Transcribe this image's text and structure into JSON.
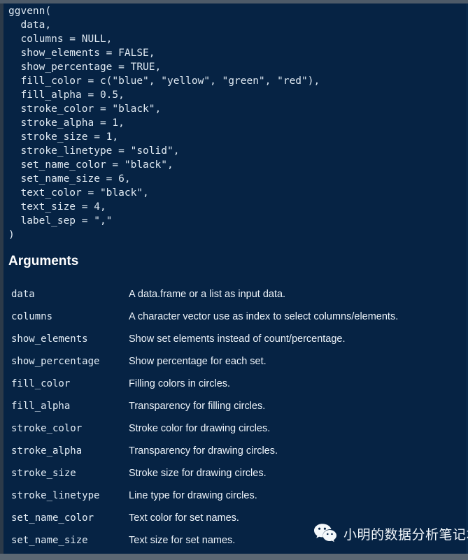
{
  "theme": {
    "background": "#062344",
    "text_color": "#e3edf6",
    "heading_color": "#ffffff",
    "chrome_top": "#4d5a68",
    "chrome_bottom": "#5b6773"
  },
  "code": {
    "lines": [
      "ggvenn(",
      "  data,",
      "  columns = NULL,",
      "  show_elements = FALSE,",
      "  show_percentage = TRUE,",
      "  fill_color = c(\"blue\", \"yellow\", \"green\", \"red\"),",
      "  fill_alpha = 0.5,",
      "  stroke_color = \"black\",",
      "  stroke_alpha = 1,",
      "  stroke_size = 1,",
      "  stroke_linetype = \"solid\",",
      "  set_name_color = \"black\",",
      "  set_name_size = 6,",
      "  text_color = \"black\",",
      "  text_size = 4,",
      "  label_sep = \",\"",
      ")"
    ]
  },
  "arguments_section": {
    "heading": "Arguments",
    "rows": [
      {
        "name": "data",
        "description": "A data.frame or a list as input data."
      },
      {
        "name": "columns",
        "description": "A character vector use as index to select columns/elements."
      },
      {
        "name": "show_elements",
        "description": "Show set elements instead of count/percentage."
      },
      {
        "name": "show_percentage",
        "description": "Show percentage for each set."
      },
      {
        "name": "fill_color",
        "description": "Filling colors in circles."
      },
      {
        "name": "fill_alpha",
        "description": "Transparency for filling circles."
      },
      {
        "name": "stroke_color",
        "description": "Stroke color for drawing circles."
      },
      {
        "name": "stroke_alpha",
        "description": "Transparency for drawing circles."
      },
      {
        "name": "stroke_size",
        "description": "Stroke size for drawing circles."
      },
      {
        "name": "stroke_linetype",
        "description": "Line type for drawing circles."
      },
      {
        "name": "set_name_color",
        "description": "Text color for set names."
      },
      {
        "name": "set_name_size",
        "description": "Text size for set names."
      }
    ]
  },
  "watermark": {
    "icon": "wechat-icon",
    "text": "小明的数据分析笔记本"
  }
}
